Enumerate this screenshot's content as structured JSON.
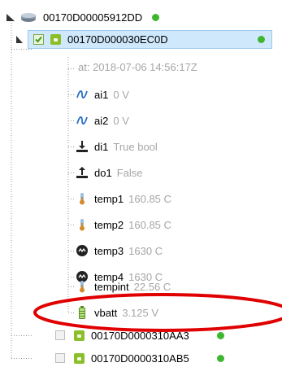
{
  "colors": {
    "status_online": "#3fb62f",
    "selection_bg": "#cfe8fb",
    "value_text": "#a6a6a6",
    "annotation_ellipse": "#e00000"
  },
  "root": {
    "label": "00170D00005912DD",
    "icon": "network-device-icon",
    "status": "online",
    "expanded": true
  },
  "selected_device": {
    "label": "00170D000030EC0D",
    "checked": true,
    "status": "online",
    "timestamp": "at: 2018-07-06 14:56:17Z"
  },
  "channels": [
    {
      "name": "ai1",
      "value": "0 V",
      "icon": "analog-wave-icon"
    },
    {
      "name": "ai2",
      "value": "0 V",
      "icon": "analog-wave-icon"
    },
    {
      "name": "di1",
      "value": "True bool",
      "icon": "digital-input-icon"
    },
    {
      "name": "do1",
      "value": "False",
      "icon": "digital-output-icon"
    },
    {
      "name": "temp1",
      "value": "160.85 C",
      "icon": "thermometer-icon"
    },
    {
      "name": "temp2",
      "value": "160.85 C",
      "icon": "thermometer-icon"
    },
    {
      "name": "temp3",
      "value": "1630 C",
      "icon": "sensor-dial-icon"
    },
    {
      "name": "temp4",
      "value": "1630 C",
      "icon": "sensor-dial-icon"
    },
    {
      "name": "tempint",
      "value": "22.56 C",
      "icon": "thermometer-icon"
    },
    {
      "name": "vbatt",
      "value": "3.125 V",
      "icon": "battery-icon"
    }
  ],
  "other_devices": [
    {
      "label": "00170D0000310AA3",
      "checked": false,
      "status": "online"
    },
    {
      "label": "00170D0000310AB5",
      "checked": false,
      "status": "online"
    }
  ]
}
